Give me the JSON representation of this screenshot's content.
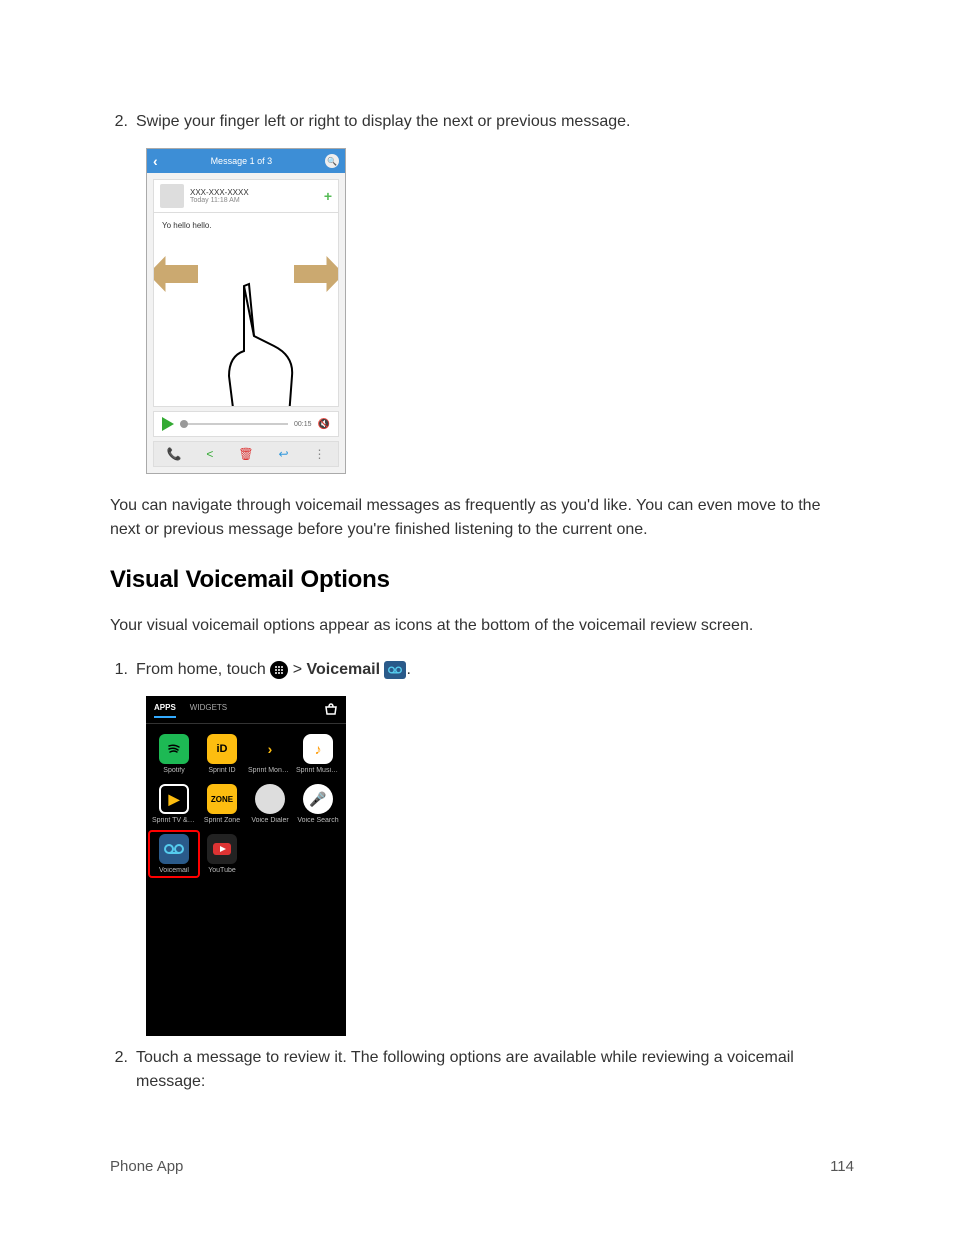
{
  "step2": {
    "num": "2.",
    "text": "Swipe your finger left or right to display the next or previous message."
  },
  "shot1": {
    "header_title": "Message 1 of 3",
    "from": "XXX-XXX-XXXX",
    "time": "Today 11:18 AM",
    "transcript": "Yo hello hello.",
    "duration": "00:15"
  },
  "para1": "You can navigate through voicemail messages as frequently as you'd like. You can even move to the next or previous message before you're finished listening to the current one.",
  "heading": "Visual Voicemail Options",
  "para2": "Your visual voicemail options appear as icons at the bottom of the voicemail review screen.",
  "step1b": {
    "num": "1.",
    "prefix": "From home, touch ",
    "sep": " > ",
    "bold": "Voicemail",
    "suffix": "."
  },
  "shot2": {
    "tab_apps": "APPS",
    "tab_widgets": "WIDGETS",
    "apps": [
      {
        "label": "Spotify"
      },
      {
        "label": "Sprint ID"
      },
      {
        "label": "Sprint Money..."
      },
      {
        "label": "Sprint Music..."
      },
      {
        "label": "Sprint TV & M..."
      },
      {
        "label": "Sprint Zone"
      },
      {
        "label": "Voice Dialer"
      },
      {
        "label": "Voice Search"
      },
      {
        "label": "Voicemail"
      },
      {
        "label": "YouTube"
      }
    ]
  },
  "step2b": {
    "num": "2.",
    "text": "Touch a message to review it. The following options are available while reviewing a voicemail message:"
  },
  "footer": {
    "left": "Phone App",
    "right": "114"
  }
}
